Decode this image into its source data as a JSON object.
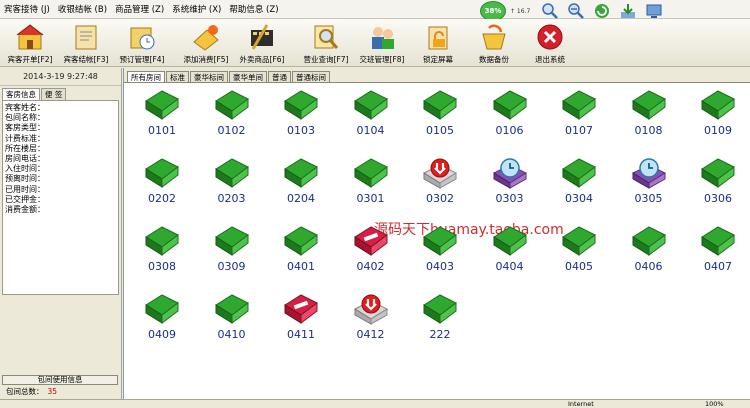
{
  "menu": [
    "宾客接待 (J)",
    "收银结帐 (B)",
    "商品管理 (Z)",
    "系统维护 (X)",
    "帮助信息 (Z)"
  ],
  "overlay": {
    "gauge": "38%",
    "side_text": "↑ 16.7"
  },
  "toolbar": [
    {
      "label": "宾客开单[F2]"
    },
    {
      "label": "宾客结帐[F3]"
    },
    {
      "label": "预订管理[F4]"
    },
    {
      "label": "添加消费[F5]"
    },
    {
      "label": "外卖商品[F6]"
    },
    {
      "label": "营业查询[F7]"
    },
    {
      "label": "交班管理[F8]"
    },
    {
      "label": "锁定屏幕"
    },
    {
      "label": "数据备份"
    },
    {
      "label": "退出系统"
    }
  ],
  "left": {
    "date": "2014-3-19  9:27:48",
    "tabs": [
      "客房信息",
      "便 签"
    ],
    "fields": [
      "宾客姓名：",
      "包间名称：",
      "客房类型：",
      "计费标准：",
      "所在楼层：",
      "房间电话：",
      "入住时间：",
      "预离时间：",
      "已用时间：",
      "已交押金：",
      "消费金额："
    ],
    "bottom_bar": "包间使用信息",
    "total_label": "包间总数：",
    "total_value": "35"
  },
  "room_tabs": [
    "所有房间",
    "标准",
    "豪华标间",
    "豪华单间",
    "普通",
    "普通标间"
  ],
  "rooms": [
    {
      "num": "0101",
      "status": "free"
    },
    {
      "num": "0102",
      "status": "free"
    },
    {
      "num": "0103",
      "status": "free"
    },
    {
      "num": "0104",
      "status": "free"
    },
    {
      "num": "0105",
      "status": "free"
    },
    {
      "num": "0106",
      "status": "free"
    },
    {
      "num": "0107",
      "status": "free"
    },
    {
      "num": "0108",
      "status": "free"
    },
    {
      "num": "0109",
      "status": "free"
    },
    {
      "num": "0202",
      "status": "free"
    },
    {
      "num": "0203",
      "status": "free"
    },
    {
      "num": "0204",
      "status": "free"
    },
    {
      "num": "0301",
      "status": "free"
    },
    {
      "num": "0302",
      "status": "reserved"
    },
    {
      "num": "0303",
      "status": "timed"
    },
    {
      "num": "0304",
      "status": "free"
    },
    {
      "num": "0305",
      "status": "timed"
    },
    {
      "num": "0306",
      "status": "free"
    },
    {
      "num": "0308",
      "status": "free"
    },
    {
      "num": "0309",
      "status": "free"
    },
    {
      "num": "0401",
      "status": "free"
    },
    {
      "num": "0402",
      "status": "occupied"
    },
    {
      "num": "0403",
      "status": "free"
    },
    {
      "num": "0404",
      "status": "free"
    },
    {
      "num": "0405",
      "status": "free"
    },
    {
      "num": "0406",
      "status": "free"
    },
    {
      "num": "0407",
      "status": "free"
    },
    {
      "num": "0409",
      "status": "free"
    },
    {
      "num": "0410",
      "status": "free"
    },
    {
      "num": "0411",
      "status": "occupied"
    },
    {
      "num": "0412",
      "status": "reserved"
    },
    {
      "num": "222",
      "status": "free"
    }
  ],
  "watermark": "源码天下huamay.taoba.com",
  "status": {
    "internet": "Internet",
    "zoom": "100%"
  },
  "colors": {
    "free": "#2fa82f",
    "occupied": "#d61f44",
    "reserved": "#e21b1b",
    "timed": "#8a4fb5",
    "room_label": "#1a2d8c"
  }
}
